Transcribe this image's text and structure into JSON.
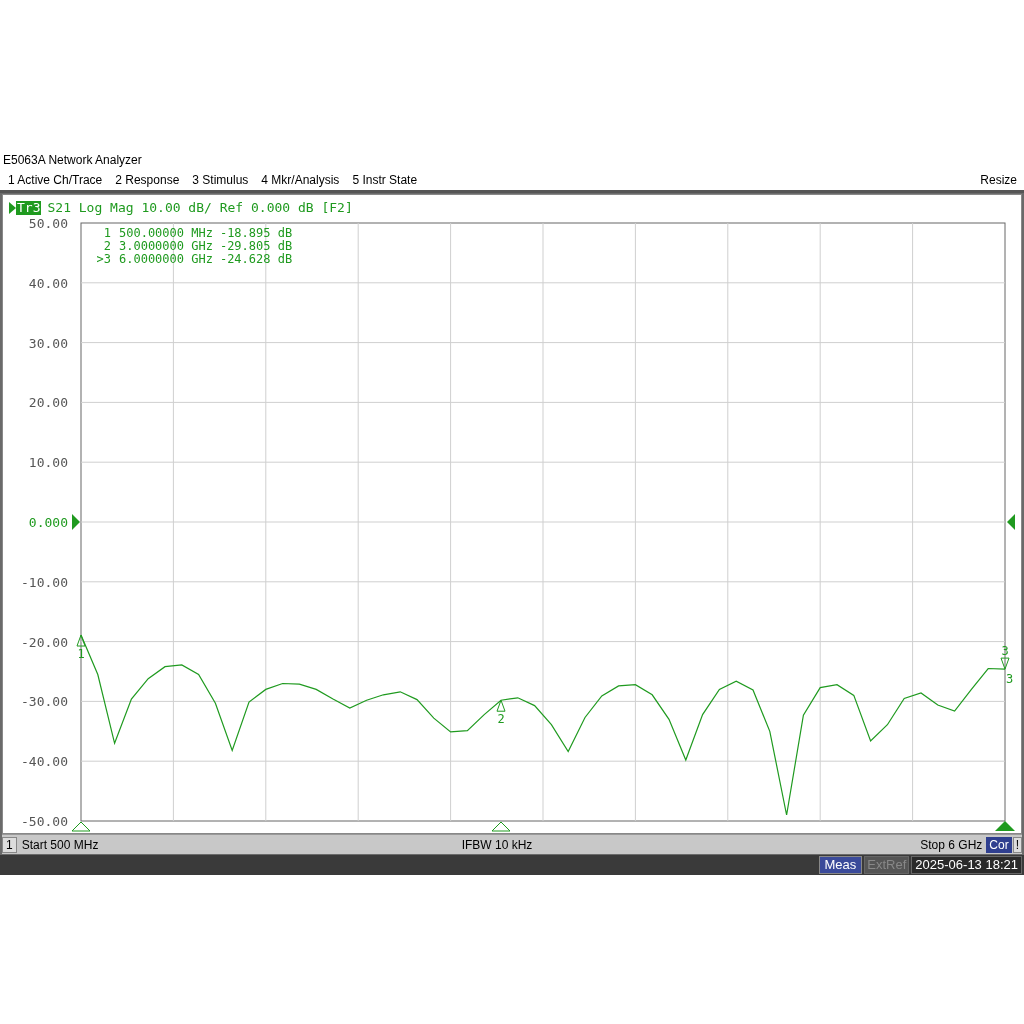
{
  "window": {
    "title": "E5063A Network Analyzer"
  },
  "menu": [
    {
      "label": "1 Active Ch/Trace"
    },
    {
      "label": "2 Response"
    },
    {
      "label": "3 Stimulus"
    },
    {
      "label": "4 Mkr/Analysis"
    },
    {
      "label": "5 Instr State"
    }
  ],
  "menu_right": "Resize",
  "trace_header": {
    "badge": "Tr3",
    "text": "S21 Log Mag 10.00 dB/ Ref 0.000 dB [F2]"
  },
  "marker_table": [
    {
      "label": "1",
      "stimulus": "500.00000 MHz",
      "response": "-18.895 dB"
    },
    {
      "label": "2",
      "stimulus": "3.0000000 GHz",
      "response": "-29.805 dB"
    },
    {
      "label": ">3",
      "stimulus": "6.0000000 GHz",
      "response": "-24.628 dB"
    }
  ],
  "chart_data": {
    "type": "line",
    "yticks": [
      {
        "value": 50,
        "label": "50.00"
      },
      {
        "value": 40,
        "label": "40.00"
      },
      {
        "value": 30,
        "label": "30.00"
      },
      {
        "value": 20,
        "label": "20.00"
      },
      {
        "value": 10,
        "label": "10.00"
      },
      {
        "value": 0,
        "label": "0.000"
      },
      {
        "value": -10,
        "label": "-10.00"
      },
      {
        "value": -20,
        "label": "-20.00"
      },
      {
        "value": -30,
        "label": "-30.00"
      },
      {
        "value": -40,
        "label": "-40.00"
      },
      {
        "value": -50,
        "label": "-50.00"
      }
    ],
    "grid": true,
    "categories": [
      null,
      null,
      null,
      null,
      null,
      null,
      null,
      null,
      null,
      null,
      null,
      null,
      null,
      null,
      null,
      null,
      null,
      null,
      null,
      null,
      null,
      null,
      null,
      null,
      null,
      null,
      null,
      null,
      null,
      null,
      null,
      null,
      null,
      null,
      null,
      null,
      null,
      null,
      null,
      null,
      null,
      null,
      null,
      null,
      null,
      null,
      null,
      null,
      null,
      null,
      null,
      null,
      null,
      null,
      null,
      null
    ],
    "series": [
      {
        "color": "#1f9a1f",
        "values": [
          -18.9,
          -25.5,
          -37.0,
          -29.6,
          -26.2,
          -24.2,
          -23.9,
          -25.5,
          -30.3,
          -38.2,
          -30.1,
          -28.0,
          -27.0,
          -27.1,
          -28.0,
          -29.6,
          -31.1,
          -29.8,
          -28.9,
          -28.4,
          -29.7,
          -32.8,
          -35.1,
          -34.9,
          -32.2,
          -29.8,
          -29.4,
          -30.7,
          -33.9,
          -38.4,
          -32.7,
          -29.1,
          -27.4,
          -27.2,
          -28.9,
          -33.0,
          -39.8,
          -32.2,
          -28.0,
          -26.6,
          -28.1,
          -35.0,
          -49.0,
          -32.3,
          -27.7,
          -27.2,
          -29.0,
          -36.6,
          -33.9,
          -29.5,
          -28.6,
          -30.6,
          -31.6,
          -28.0,
          -24.5,
          -24.6
        ]
      }
    ],
    "ylim": [
      -50,
      50
    ]
  },
  "trace_markers": [
    {
      "label": "1"
    },
    {
      "label": "2"
    },
    {
      "label": "3"
    }
  ],
  "trace_end_label": "3",
  "footer": {
    "channel": "1",
    "start": "Start 500 MHz",
    "ifbw": "IFBW 10 kHz",
    "stop": "Stop 6 GHz",
    "cor": "Cor",
    "warning": "!"
  },
  "status": [
    {
      "text": "Meas",
      "active": true
    },
    {
      "text": "ExtRef",
      "active": false
    }
  ],
  "datetime": "2025-06-13 18:21"
}
